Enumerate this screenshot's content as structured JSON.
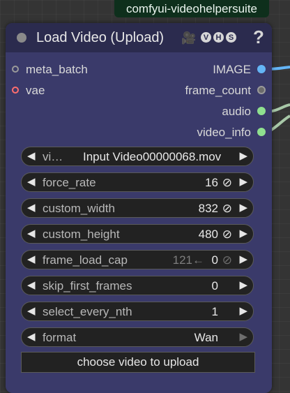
{
  "badge": "comfyui-videohelpersuite",
  "node": {
    "title": "Load Video (Upload)",
    "help_icon": "?",
    "camera_icon": "video-camera-icon",
    "vhs_letters": [
      "V",
      "H",
      "S"
    ]
  },
  "inputs": [
    {
      "label": "meta_batch",
      "color": "#9a9a9a"
    },
    {
      "label": "vae",
      "color": "#ff6e6e"
    }
  ],
  "outputs": [
    {
      "label": "IMAGE",
      "color": "#64b5f6"
    },
    {
      "label": "frame_count",
      "color": "#6b6b6b"
    },
    {
      "label": "audio",
      "color": "#8fe08f"
    },
    {
      "label": "video_info",
      "color": "#8fe08f"
    }
  ],
  "widgets": {
    "video": {
      "label": "vi…",
      "value": "Input Video00000068.mov"
    },
    "force_rate": {
      "label": "force_rate",
      "value": "16",
      "null_icon": "⊘"
    },
    "custom_width": {
      "label": "custom_width",
      "value": "832",
      "null_icon": "⊘"
    },
    "custom_height": {
      "label": "custom_height",
      "value": "480",
      "null_icon": "⊘"
    },
    "frame_load_cap": {
      "label": "frame_load_cap",
      "prev": "121←",
      "value": "0",
      "null_icon": "⊘"
    },
    "skip_first_frames": {
      "label": "skip_first_frames",
      "value": "0"
    },
    "select_every_nth": {
      "label": "select_every_nth",
      "value": "1"
    },
    "format": {
      "label": "format",
      "value": "Wan"
    }
  },
  "upload_button": "choose video to upload",
  "arrows": {
    "left": "◀",
    "right": "▶"
  }
}
